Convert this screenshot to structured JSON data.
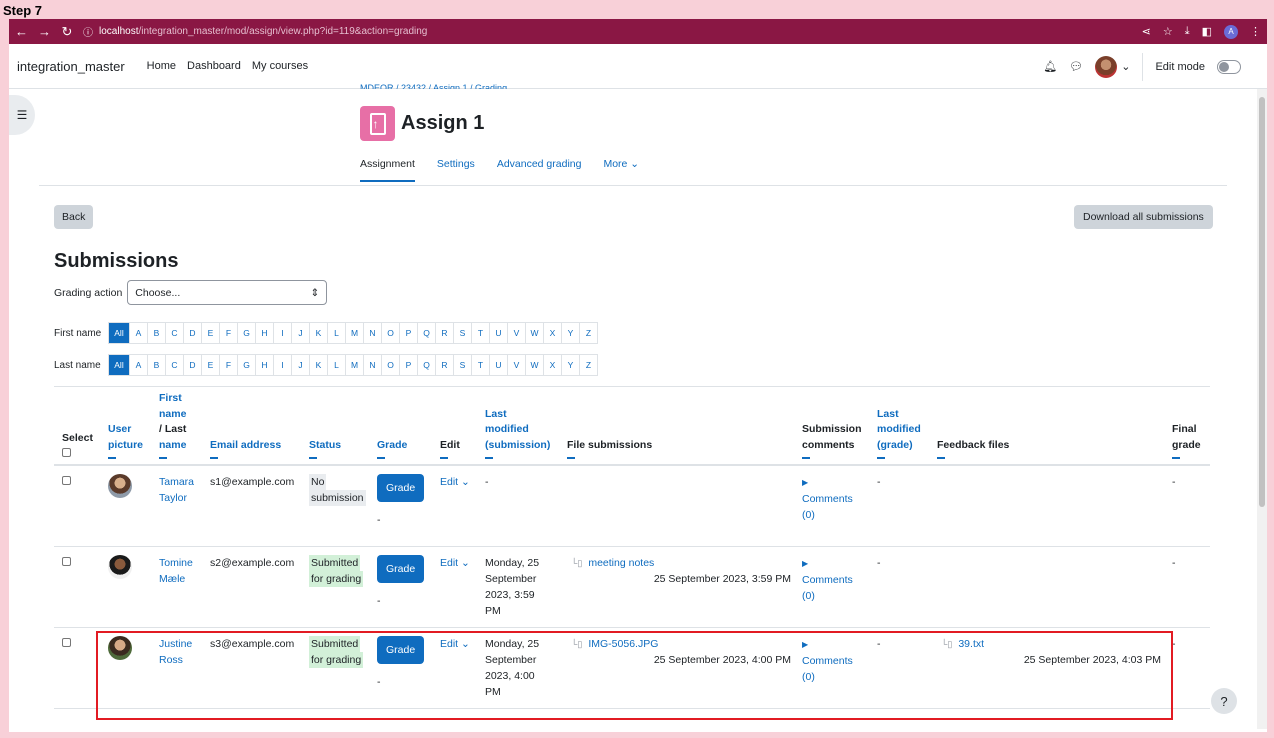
{
  "step_label": "Step 7",
  "browser": {
    "url_host": "localhost",
    "url_path": "/integration_master/mod/assign/view.php?id=119&action=grading",
    "profile_initial": "A"
  },
  "navbar": {
    "site_name": "integration_master",
    "links": [
      "Home",
      "Dashboard",
      "My courses"
    ],
    "edit_mode_label": "Edit mode"
  },
  "breadcrumb_partial": "MDEQR / 23432 / Assign 1 / Grading",
  "page": {
    "title": "Assign 1",
    "tabs": [
      "Assignment",
      "Settings",
      "Advanced grading",
      "More ⌄"
    ],
    "back_label": "Back",
    "download_label": "Download all submissions",
    "submissions_heading": "Submissions",
    "grading_action_label": "Grading action",
    "grading_action_value": "Choose..."
  },
  "initials": {
    "first_name_label": "First name",
    "last_name_label": "Last name",
    "all_label": "All",
    "letters": [
      "A",
      "B",
      "C",
      "D",
      "E",
      "F",
      "G",
      "H",
      "I",
      "J",
      "K",
      "L",
      "M",
      "N",
      "O",
      "P",
      "Q",
      "R",
      "S",
      "T",
      "U",
      "V",
      "W",
      "X",
      "Y",
      "Z"
    ]
  },
  "table": {
    "headers": {
      "select": "Select",
      "user_picture_1": "User",
      "user_picture_2": "picture",
      "name_1": "First",
      "name_2": "name",
      "name_3": "/ Last",
      "name_4": "name",
      "email": "Email address",
      "status": "Status",
      "grade": "Grade",
      "edit": "Edit",
      "lastmod_1": "Last",
      "lastmod_2": "modified",
      "lastmod_3": "(submission)",
      "file_submissions": "File submissions",
      "subcomments_1": "Submission",
      "subcomments_2": "comments",
      "lastmodgrade_1": "Last",
      "lastmodgrade_2": "modified",
      "lastmodgrade_3": "(grade)",
      "feedback_files": "Feedback files",
      "final_1": "Final",
      "final_2": "grade"
    },
    "rows": [
      {
        "first": "Tamara",
        "last": "Taylor",
        "email": "s1@example.com",
        "status_1": "No",
        "status_2": "submission",
        "grade_btn": "Grade",
        "grade_value": "-",
        "edit": "Edit ⌄",
        "lastmod_1": "-",
        "lastmod_2": "",
        "lastmod_3": "",
        "lastmod_4": "",
        "file_name": "",
        "file_date": "",
        "comments_1": "Comments",
        "comments_2": "(0)",
        "lastmod_grade": "-",
        "feedback_file": "",
        "feedback_date": "",
        "final": "-"
      },
      {
        "first": "Tomine",
        "last": "Mæle",
        "email": "s2@example.com",
        "status_1": "Submitted",
        "status_2": "for grading",
        "grade_btn": "Grade",
        "grade_value": "-",
        "edit": "Edit ⌄",
        "lastmod_1": "Monday, 25",
        "lastmod_2": "September",
        "lastmod_3": "2023, 3:59",
        "lastmod_4": "PM",
        "file_name": "meeting notes",
        "file_date": "25 September 2023, 3:59 PM",
        "comments_1": "Comments",
        "comments_2": "(0)",
        "lastmod_grade": "-",
        "feedback_file": "",
        "feedback_date": "",
        "final": "-"
      },
      {
        "first": "Justine",
        "last": "Ross",
        "email": "s3@example.com",
        "status_1": "Submitted",
        "status_2": "for grading",
        "grade_btn": "Grade",
        "grade_value": "-",
        "edit": "Edit ⌄",
        "lastmod_1": "Monday, 25",
        "lastmod_2": "September",
        "lastmod_3": "2023, 4:00",
        "lastmod_4": "PM",
        "file_name": "IMG-5056.JPG",
        "file_date": "25 September 2023, 4:00 PM",
        "comments_1": "Comments",
        "comments_2": "(0)",
        "lastmod_grade": "-",
        "feedback_file": "39.txt",
        "feedback_date": "25 September 2023, 4:03 PM",
        "final": "-"
      }
    ]
  },
  "help_label": "?",
  "colors": {
    "accent": "#0f6cbf",
    "chrome": "#8a1744",
    "highlight": "#e21b23",
    "assign_icon": "#e76fa6"
  }
}
